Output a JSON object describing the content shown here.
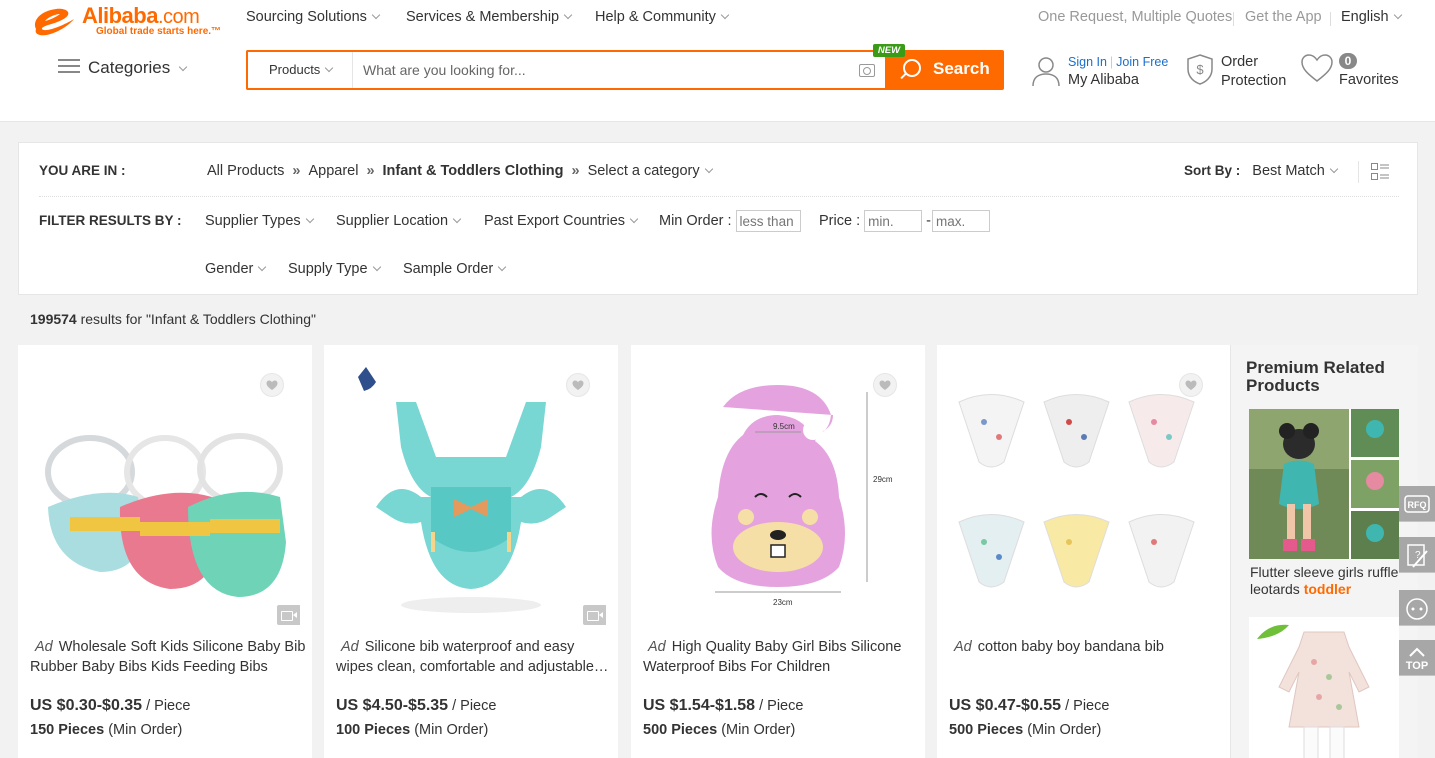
{
  "header": {
    "logo_word": "Alibaba",
    "logo_com": ".com",
    "logo_tagline": "Global trade starts here.™",
    "nav": [
      "Sourcing Solutions",
      "Services & Membership",
      "Help & Community"
    ],
    "right_links": [
      "One Request, Multiple Quotes",
      "Get the App"
    ],
    "language": "English",
    "categories_label": "Categories",
    "search": {
      "category": "Products",
      "placeholder": "What are you looking for...",
      "button": "Search",
      "new_badge": "NEW"
    },
    "account": {
      "sign_in": "Sign In",
      "join_free": "Join Free",
      "label": "My Alibaba"
    },
    "order_protection": [
      "Order",
      "Protection"
    ],
    "favorites": {
      "count": "0",
      "label": "Favorites"
    }
  },
  "filters": {
    "you_are_in_label": "YOU ARE IN :",
    "breadcrumb": [
      "All Products",
      "Apparel",
      "Infant & Toddlers Clothing"
    ],
    "separator": "»",
    "select_category": "Select a category",
    "sort_label": "Sort By :",
    "sort_value": "Best Match",
    "filter_label": "FILTER RESULTS BY :",
    "row1": [
      "Supplier Types",
      "Supplier Location",
      "Past Export Countries"
    ],
    "min_order_label": "Min Order :",
    "min_order_placeholder": "less than",
    "price_label": "Price :",
    "price_min_placeholder": "min.",
    "price_dash": "-",
    "price_max_placeholder": "max.",
    "row2": [
      "Gender",
      "Supply Type",
      "Sample Order"
    ]
  },
  "results": {
    "count": "199574",
    "text": " results for \"Infant & Toddlers Clothing\""
  },
  "products": [
    {
      "ad": "Ad",
      "title": "Wholesale Soft Kids Silicone Baby Bib Rubber Baby Bibs Kids Feeding Bibs",
      "price": "US $0.30-$0.35",
      "unit": " / Piece",
      "moq": "150 Pieces",
      "moq_suffix": " (Min Order)",
      "has_video": true
    },
    {
      "ad": "Ad",
      "title": "Silicone bib waterproof and easy wipes clean, comfortable and adjustable…",
      "price": "US $4.50-$5.35",
      "unit": " / Piece",
      "moq": "100 Pieces",
      "moq_suffix": " (Min Order)",
      "has_video": true
    },
    {
      "ad": "Ad",
      "title": "High Quality Baby Girl Bibs Silicone Waterproof Bibs For Children",
      "price": "US $1.54-$1.58",
      "unit": " / Piece",
      "moq": "500 Pieces",
      "moq_suffix": " (Min Order)",
      "has_video": false,
      "dims": {
        "top": "9.5cm",
        "side": "29cm",
        "bottom": "23cm"
      }
    },
    {
      "ad": "Ad",
      "title": "cotton baby boy bandana bib",
      "price": "US $0.47-$0.55",
      "unit": " / Piece",
      "moq": "500 Pieces",
      "moq_suffix": " (Min Order)",
      "has_video": false
    }
  ],
  "premium": {
    "title": "Premium Related Products",
    "caption": "Flutter sleeve girls ruffle leotards ",
    "caption_highlight": "toddler"
  },
  "float_tools": {
    "rfq": "RFQ",
    "top": "TOP"
  },
  "colors": {
    "brand_orange": "#ff6a00",
    "link_blue": "#1a6fcc",
    "new_green": "#3a9b17"
  }
}
